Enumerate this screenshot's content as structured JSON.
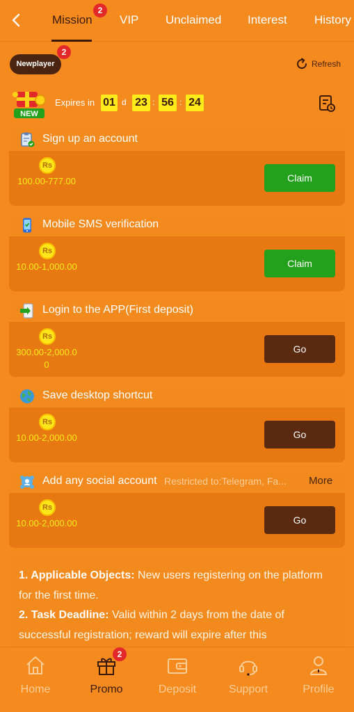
{
  "top_nav": {
    "tabs": [
      {
        "label": "Mission",
        "badge": "2",
        "active": true
      },
      {
        "label": "VIP"
      },
      {
        "label": "Unclaimed"
      },
      {
        "label": "Interest"
      },
      {
        "label": "History"
      }
    ]
  },
  "newplayer": {
    "label": "Newplayer",
    "badge": "2"
  },
  "refresh_label": "Refresh",
  "gift_badge": "NEW",
  "countdown": {
    "label": "Expires in",
    "days": "01",
    "day_unit": "d",
    "hours": "23",
    "minutes": "56",
    "seconds": "24",
    "sep": ":"
  },
  "tasks": [
    {
      "title": "Sign up an account",
      "coin": "Rs",
      "reward": "100.00-777.00",
      "button": "Claim",
      "button_type": "claim",
      "icon": "clipboard-check-icon"
    },
    {
      "title": "Mobile SMS verification",
      "coin": "Rs",
      "reward": "10.00-1,000.00",
      "button": "Claim",
      "button_type": "claim",
      "icon": "phone-icon"
    },
    {
      "title": "Login to the APP(First deposit)",
      "coin": "Rs",
      "reward": "300.00-2,000.00",
      "button": "Go",
      "button_type": "go",
      "icon": "app-login-icon"
    },
    {
      "title": "Save desktop shortcut",
      "coin": "Rs",
      "reward": "10.00-2,000.00",
      "button": "Go",
      "button_type": "go",
      "icon": "globe-icon"
    },
    {
      "title": "Add any social account",
      "restriction": "Restricted to:Telegram, Fa...",
      "more": "More",
      "coin": "Rs",
      "reward": "10.00-2,000.00",
      "button": "Go",
      "button_type": "go",
      "icon": "social-icon"
    }
  ],
  "rules": [
    {
      "heading": "1. Applicable Objects:",
      "text": " New users registering on the platform for the first time."
    },
    {
      "heading": "2. Task Deadline:",
      "text": " Valid within 2 days from the date of successful registration; reward will expire after this"
    }
  ],
  "bottom_nav": [
    {
      "label": "Home",
      "icon": "home-icon"
    },
    {
      "label": "Promo",
      "icon": "gift-icon",
      "badge": "2",
      "active": true
    },
    {
      "label": "Deposit",
      "icon": "wallet-icon"
    },
    {
      "label": "Support",
      "icon": "headset-icon"
    },
    {
      "label": "Profile",
      "icon": "profile-icon"
    }
  ],
  "colors": {
    "background": "#f58a1f",
    "card": "#e87912",
    "claim_button": "#23a01c",
    "go_button": "#5a2a10",
    "badge": "#e3282a",
    "accent_yellow": "#ffeb1a",
    "dark_brown": "#3b1a08"
  }
}
